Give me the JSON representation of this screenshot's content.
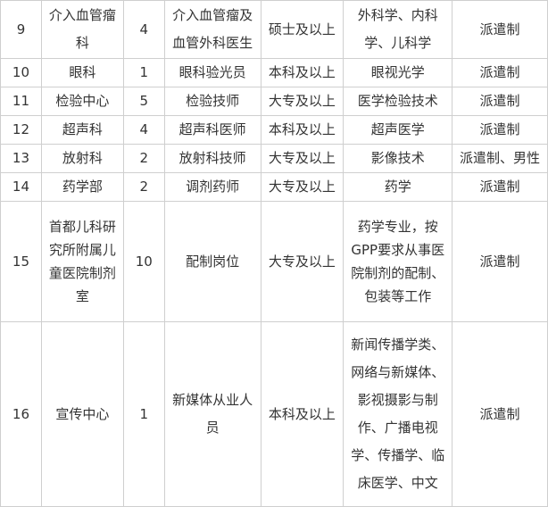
{
  "rows": [
    {
      "no": "9",
      "dept": "介入血管瘤科",
      "count": "4",
      "position": "介入血管瘤及血管外科医生",
      "education": "硕士及以上",
      "major": "外科学、内科学、儿科学",
      "type": "派遣制"
    },
    {
      "no": "10",
      "dept": "眼科",
      "count": "1",
      "position": "眼科验光员",
      "education": "本科及以上",
      "major": "眼视光学",
      "type": "派遣制"
    },
    {
      "no": "11",
      "dept": "检验中心",
      "count": "5",
      "position": "检验技师",
      "education": "大专及以上",
      "major": "医学检验技术",
      "type": "派遣制"
    },
    {
      "no": "12",
      "dept": "超声科",
      "count": "4",
      "position": "超声科医师",
      "education": "本科及以上",
      "major": "超声医学",
      "type": "派遣制"
    },
    {
      "no": "13",
      "dept": "放射科",
      "count": "2",
      "position": "放射科技师",
      "education": "大专及以上",
      "major": "影像技术",
      "type": "派遣制、男性"
    },
    {
      "no": "14",
      "dept": "药学部",
      "count": "2",
      "position": "调剂药师",
      "education": "大专及以上",
      "major": "药学",
      "type": "派遣制"
    },
    {
      "no": "15",
      "dept": "首都儿科研究所附属儿童医院制剂室",
      "count": "10",
      "position": "配制岗位",
      "education": "大专及以上",
      "major": "药学专业，按GPP要求从事医院制剂的配制、包装等工作",
      "type": "派遣制"
    },
    {
      "no": "16",
      "dept": "宣传中心",
      "count": "1",
      "position": "新媒体从业人员",
      "education": "本科及以上",
      "major": "新闻传播学类、网络与新媒体、影视摄影与制作、广播电视学、传播学、临床医学、中文",
      "type": "派遣制"
    }
  ]
}
